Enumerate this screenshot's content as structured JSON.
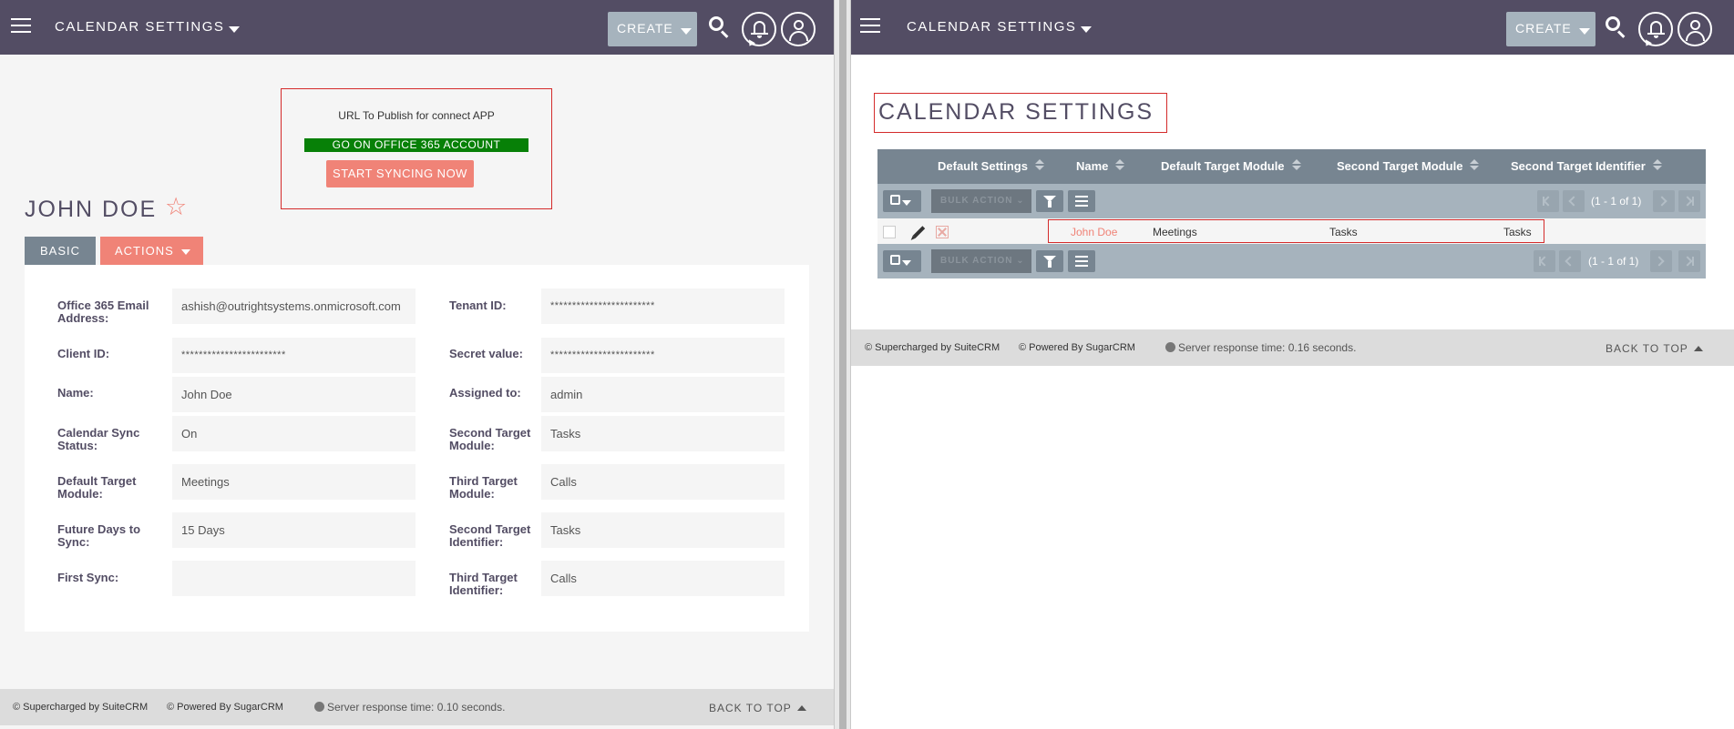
{
  "left": {
    "header": {
      "module_title": "CALENDAR SETTINGS",
      "create_label": "CREATE"
    },
    "publish": {
      "title": "URL To Publish for connect APP",
      "office_button": "GO ON OFFICE 365 ACCOUNT",
      "sync_button": "START SYNCING NOW"
    },
    "record": {
      "title": "JOHN DOE"
    },
    "tabs": {
      "basic": "BASIC",
      "actions": "ACTIONS"
    },
    "fields": {
      "office365_email": {
        "label": "Office 365 Email Address:",
        "value": "ashish@outrightsystems.onmicrosoft.com"
      },
      "tenant_id": {
        "label": "Tenant ID:",
        "value": "************************"
      },
      "client_id": {
        "label": "Client ID:",
        "value": "************************"
      },
      "secret_value": {
        "label": "Secret value:",
        "value": "************************"
      },
      "name": {
        "label": "Name:",
        "value": "John Doe"
      },
      "assigned_to": {
        "label": "Assigned to:",
        "value": "admin"
      },
      "calendar_sync_status": {
        "label": "Calendar Sync Status:",
        "value": "On"
      },
      "second_target_module": {
        "label": "Second Target Module:",
        "value": "Tasks"
      },
      "default_target_module": {
        "label": "Default Target Module:",
        "value": "Meetings"
      },
      "third_target_module": {
        "label": "Third Target Module:",
        "value": "Calls"
      },
      "future_days_to_sync": {
        "label": "Future Days to Sync:",
        "value": "15 Days"
      },
      "second_target_identifier": {
        "label": "Second Target Identifier:",
        "value": "Tasks"
      },
      "first_sync": {
        "label": "First Sync:",
        "value": ""
      },
      "third_target_identifier": {
        "label": "Third Target Identifier:",
        "value": "Calls"
      }
    },
    "footer": {
      "supercharged": "© Supercharged by SuiteCRM",
      "powered": "© Powered By SugarCRM",
      "server_time": "Server response time: 0.10 seconds.",
      "back_to_top": "BACK TO TOP"
    }
  },
  "right": {
    "header": {
      "module_title": "CALENDAR SETTINGS",
      "create_label": "CREATE"
    },
    "list_title": "CALENDAR SETTINGS",
    "columns": [
      "Default Settings",
      "Name",
      "Default Target Module",
      "Second Target Module",
      "Second Target Identifier"
    ],
    "bulk_action": "BULK ACTION",
    "pagination": "(1 - 1 of 1)",
    "rows": [
      {
        "name": "John Doe",
        "default_target_module": "Meetings",
        "second_target_module": "Tasks",
        "second_target_identifier": "Tasks"
      }
    ],
    "footer": {
      "supercharged": "© Supercharged by SuiteCRM",
      "powered": "© Powered By SugarCRM",
      "server_time": "Server response time: 0.16 seconds.",
      "back_to_top": "BACK TO TOP"
    }
  },
  "colors": {
    "topbar": "#534d64",
    "accent": "#f08377",
    "office_green": "#078007",
    "highlight_red": "#d42b2b",
    "list_header": "#778591"
  }
}
